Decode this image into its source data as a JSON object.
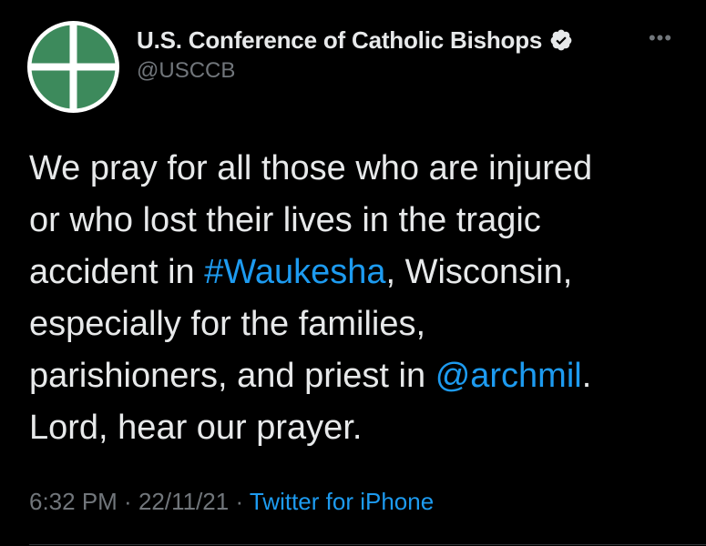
{
  "author": {
    "display_name": "U.S. Conference of Catholic Bishops",
    "handle": "@USCCB",
    "verified": true,
    "avatar_icon": "usccb-cross-logo-icon",
    "avatar_color": "#3d8a5c"
  },
  "more_icon": "more-options-icon",
  "tweet": {
    "lines": [
      {
        "parts": [
          {
            "text": "We pray for all those who are injured"
          }
        ]
      },
      {
        "parts": [
          {
            "text": "or who lost their lives in the tragic"
          }
        ]
      },
      {
        "parts": [
          {
            "text": "accident in "
          },
          {
            "text": "#Waukesha"
          },
          {
            "text": ", Wisconsin,"
          }
        ]
      },
      {
        "parts": [
          {
            "text": "especially for the families,"
          }
        ]
      },
      {
        "parts": [
          {
            "text": "parishioners, and priest in "
          },
          {
            "text": "@archmil"
          },
          {
            "text": "."
          }
        ]
      },
      {
        "parts": [
          {
            "text": "Lord, hear our prayer."
          }
        ]
      }
    ]
  },
  "meta": {
    "time": "6:32 PM",
    "separator": " · ",
    "date": "22/11/21",
    "source": "Twitter for iPhone"
  },
  "colors": {
    "background": "#000000",
    "text": "#e7e9ea",
    "secondary": "#71767b",
    "link": "#1d9bf0"
  }
}
